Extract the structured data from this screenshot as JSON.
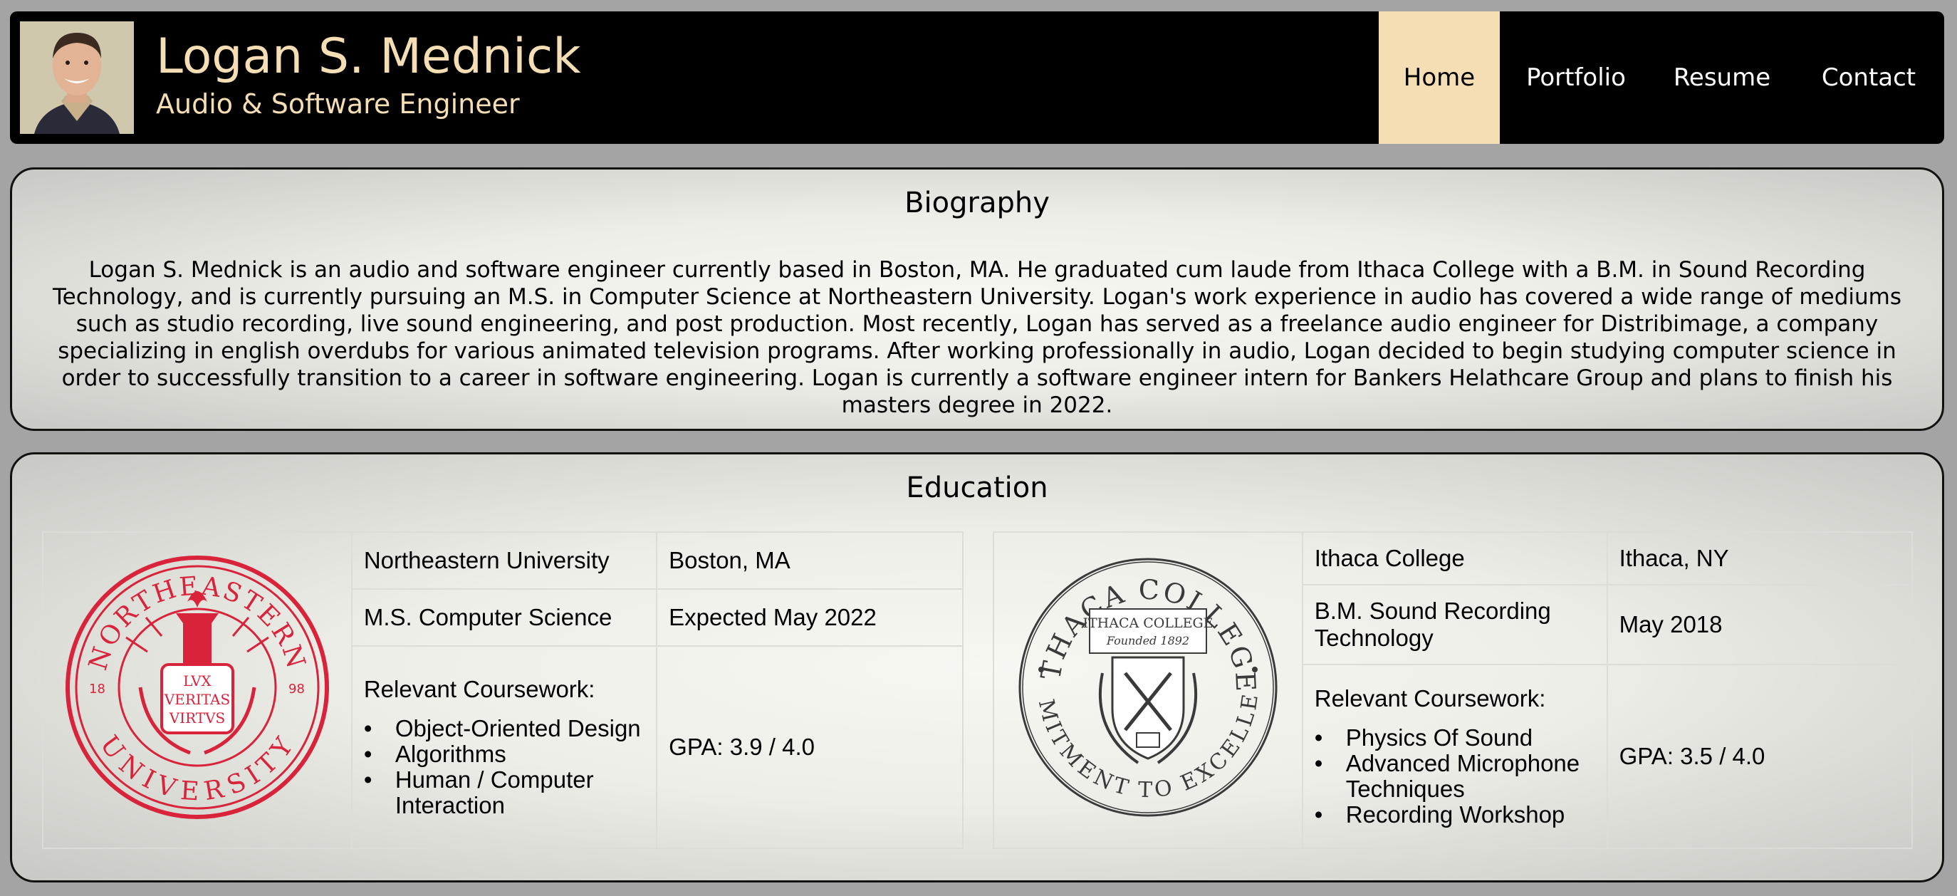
{
  "header": {
    "name": "Logan S. Mednick",
    "subtitle": "Audio & Software Engineer",
    "nav": [
      {
        "label": "Home",
        "active": true
      },
      {
        "label": "Portfolio",
        "active": false
      },
      {
        "label": "Resume",
        "active": false
      },
      {
        "label": "Contact",
        "active": false
      }
    ]
  },
  "biography": {
    "title": "Biography",
    "text": "Logan S. Mednick is an audio and software engineer currently based in Boston, MA. He graduated cum laude from Ithaca College with a B.M. in Sound Recording Technology, and is currently pursuing an M.S. in Computer Science at Northeastern University. Logan's work experience in audio has covered a wide range of mediums such as studio recording, live sound engineering, and post production. Most recently, Logan has served as a freelance audio engineer for Distribimage, a company specializing in english overdubs for various animated television programs. After working professionally in audio, Logan decided to begin studying computer science in order to successfully transition to a career in software engineering. Logan is currently a software engineer intern for Bankers Helathcare Group and plans to finish his masters degree in 2022."
  },
  "education": {
    "title": "Education",
    "schools": [
      {
        "name": "Northeastern University",
        "location": "Boston, MA",
        "degree": "M.S. Computer Science",
        "date": "Expected May 2022",
        "coursework_label": "Relevant Coursework:",
        "coursework": [
          "Object-Oriented Design",
          "Algorithms",
          "Human / Computer Interaction"
        ],
        "gpa": "GPA: 3.9 / 4.0",
        "seal": {
          "top_text": "NORTHEASTERN",
          "bottom_text": "UNIVERSITY",
          "motto": [
            "LVX",
            "VERITAS",
            "VIRTVS"
          ],
          "year_left": "18",
          "year_right": "98",
          "color": "#d9233a"
        }
      },
      {
        "name": "Ithaca College",
        "location": "Ithaca, NY",
        "degree": "B.M. Sound Recording Technology",
        "date": "May 2018",
        "coursework_label": "Relevant Coursework:",
        "coursework": [
          "Physics Of Sound",
          "Advanced Microphone Techniques",
          "Recording Workshop"
        ],
        "gpa": "GPA: 3.5 / 4.0",
        "seal": {
          "top_text": "ITHACA COLLEGE",
          "bottom_text": "COMMITMENT TO EXCELLENCE",
          "inner_title": "ITHACA COLLEGE",
          "inner_sub": "Founded 1892",
          "color": "#3a3a3a"
        }
      }
    ]
  },
  "colors": {
    "accent": "#f5deb3",
    "header_bg": "#000000",
    "page_bg": "#a4a4a4"
  }
}
